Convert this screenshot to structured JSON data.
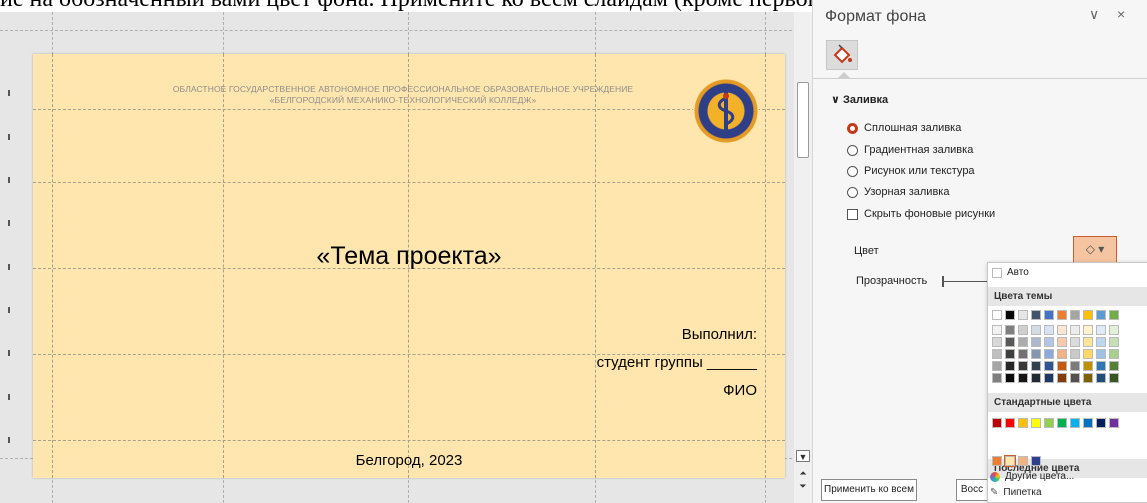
{
  "caption": "ие на обозначенный вами цвет фона. Примените ко всем слайдам (кроме первого)",
  "slide": {
    "org_line1": "ОБЛАСТНОЕ ГОСУДАРСТВЕННОЕ АВТОНОМНОЕ ПРОФЕССИОНАЛЬНОЕ ОБРАЗОВАТЕЛЬНОЕ УЧРЕЖДЕНИЕ",
    "org_line2": "«БЕЛГОРОДСКИЙ МЕХАНИКО-ТЕХНОЛОГИЧЕСКИЙ  КОЛЛЕДЖ»",
    "title": "«Тема проекта»",
    "done_label": "Выполнил:",
    "group_label": "студент группы ______",
    "name_label": "ФИО",
    "city_year": "Белгород, 2023",
    "background_color": "#ffe6ae"
  },
  "pane": {
    "title": "Формат фона",
    "section_fill": "Заливка",
    "options": [
      {
        "label": "Сплошная заливка",
        "selected": true
      },
      {
        "label": "Градиентная заливка",
        "selected": false
      },
      {
        "label": "Рисунок или текстура",
        "selected": false
      },
      {
        "label": "Узорная заливка",
        "selected": false
      }
    ],
    "hide_bg_label": "Скрыть фоновые рисунки",
    "color_label": "Цвет",
    "transparency_label": "Прозрачность",
    "apply_all_label": "Применить ко всем",
    "reset_label": "Восс",
    "icons": {
      "fill": "paint-bucket-icon",
      "collapse": "chevron-down-icon",
      "close": "close-icon"
    }
  },
  "dropdown": {
    "auto_label": "Авто",
    "theme_header": "Цвета темы",
    "standard_header": "Стандартные цвета",
    "recent_header": "Последние цвета",
    "more_colors_label": "Другие цвета...",
    "eyedropper_label": "Пипетка",
    "theme_top": [
      "#ffffff",
      "#000000",
      "#e7e6e6",
      "#44546a",
      "#4472c4",
      "#ed7d31",
      "#a5a5a5",
      "#ffc000",
      "#5b9bd5",
      "#70ad47"
    ],
    "theme_shades": [
      [
        "#f2f2f2",
        "#7f7f7f",
        "#d0cece",
        "#d6dce4",
        "#d9e2f3",
        "#fbe5d5",
        "#ededed",
        "#fff2cc",
        "#deebf6",
        "#e2efd9"
      ],
      [
        "#d8d8d8",
        "#595959",
        "#aeabab",
        "#adb9ca",
        "#b4c6e7",
        "#f7cbac",
        "#dbdbdb",
        "#fee599",
        "#bdd7ee",
        "#c5e0b3"
      ],
      [
        "#bfbfbf",
        "#3f3f3f",
        "#757070",
        "#8496b0",
        "#8eaadb",
        "#f4b183",
        "#c9c9c9",
        "#ffd965",
        "#9cc3e5",
        "#a8d08d"
      ],
      [
        "#a5a5a5",
        "#262626",
        "#3a3838",
        "#323f4f",
        "#2f5496",
        "#c55a11",
        "#7b7b7b",
        "#bf9000",
        "#2e75b5",
        "#538135"
      ],
      [
        "#7f7f7f",
        "#0c0c0c",
        "#171616",
        "#222a35",
        "#1f3864",
        "#833c0b",
        "#525252",
        "#7f6000",
        "#1e4e79",
        "#375623"
      ]
    ],
    "standard": [
      "#c00000",
      "#ff0000",
      "#ffc000",
      "#ffff00",
      "#92d050",
      "#00b050",
      "#00b0f0",
      "#0070c0",
      "#002060",
      "#7030a0"
    ],
    "recent": [
      "#ed7d31",
      "#ffe6ae",
      "#f4b183",
      "#2f3f8f"
    ]
  }
}
